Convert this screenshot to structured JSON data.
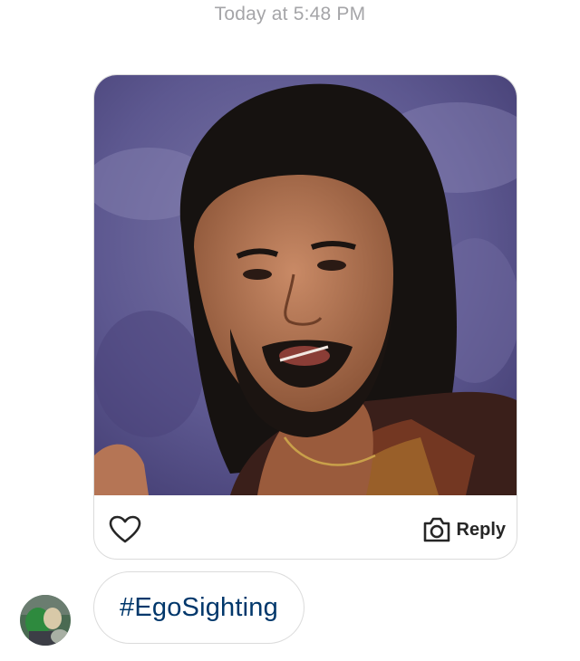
{
  "thread": {
    "timestamp": "Today at 5:48 PM"
  },
  "shared_post": {
    "reply_label": "Reply",
    "like_icon": "heart-icon",
    "reply_icon": "camera-icon"
  },
  "message": {
    "text": "#EgoSighting"
  },
  "sender": {
    "avatar": "avatar-photo"
  },
  "colors": {
    "timestamp": "#a5a5a8",
    "hashtag": "#00376b",
    "border": "#dbdbdb",
    "photo_background": "#5a5490"
  }
}
